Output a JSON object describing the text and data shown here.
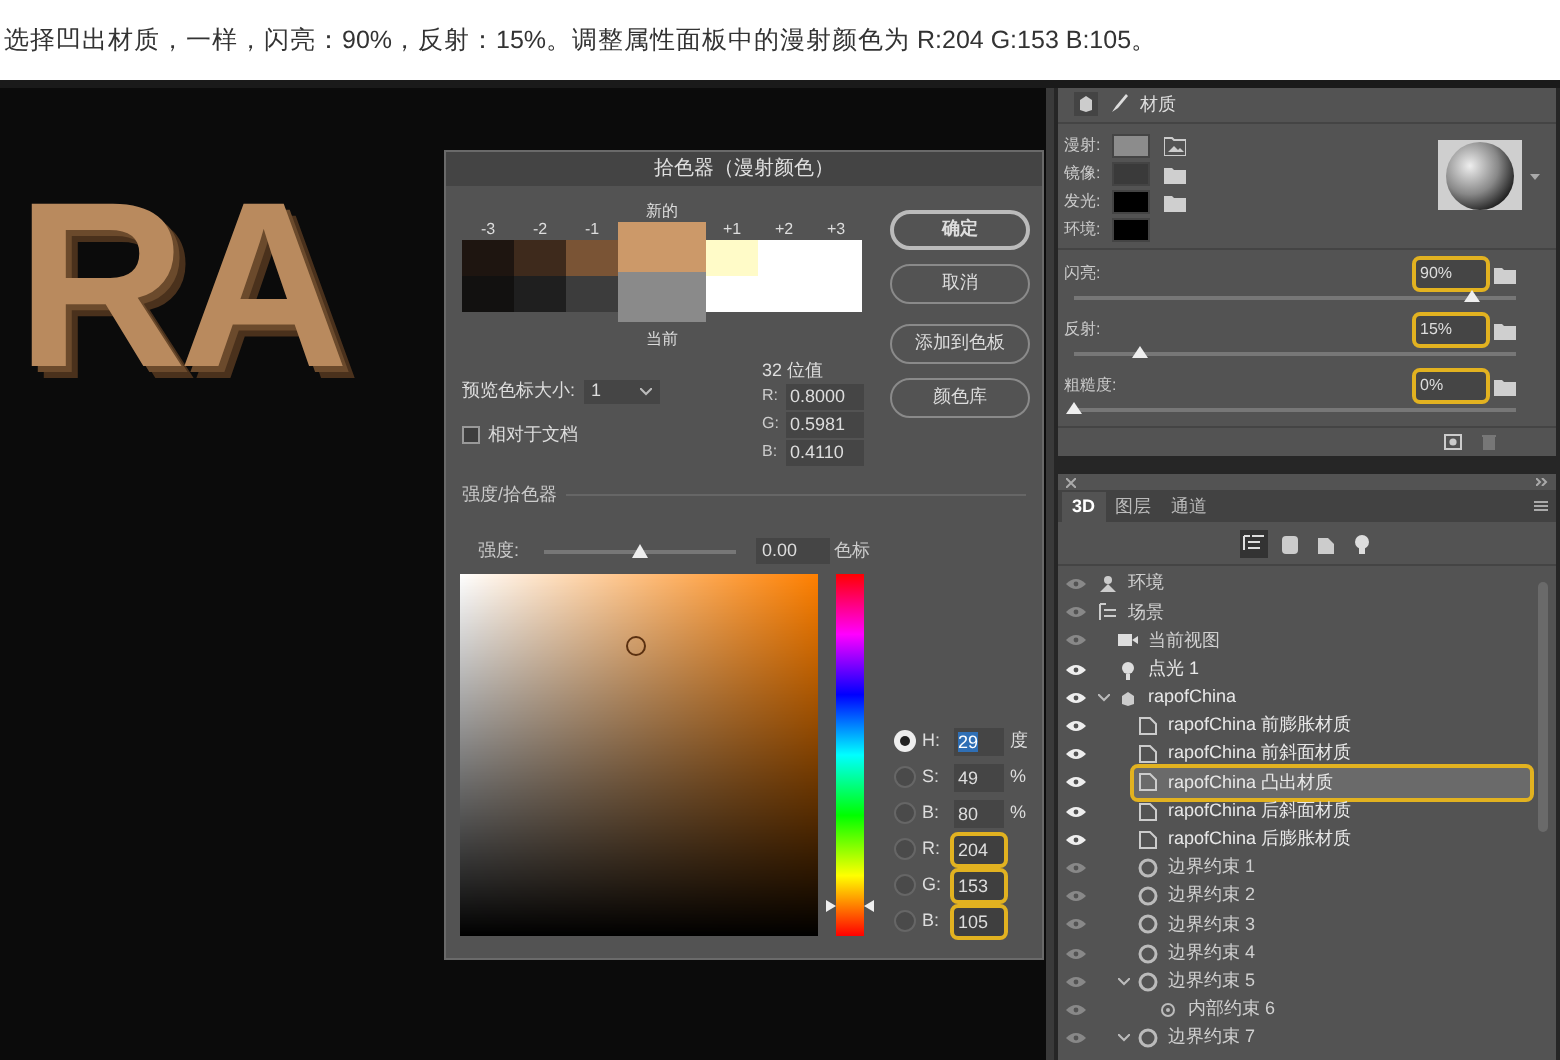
{
  "caption": "选择凹出材质，一样，闪亮：90%，反射：15%。调整属性面板中的漫射颜色为 R:204 G:153 B:105。",
  "canvas": {
    "text": "RA"
  },
  "color_picker": {
    "title": "拾色器（漫射颜色）",
    "preview": [
      {
        "label": "新的",
        "color": "#cc9969"
      },
      {
        "label": "当前",
        "color": "#8a8a8a"
      }
    ],
    "swatches": [
      {
        "label": "-3",
        "color": "#1e1510"
      },
      {
        "label": "-2",
        "color": "#3e2a1c"
      },
      {
        "label": "-1",
        "color": "#7a5435"
      },
      {
        "label": "+1",
        "color": "#fffbc8"
      },
      {
        "label": "+2",
        "color": "#ffffff"
      },
      {
        "label": "+3",
        "color": "#ffffff"
      }
    ],
    "swatches_lower": [
      {
        "color": "#121110"
      },
      {
        "color": "#1f1f1f"
      },
      {
        "color": "#3c3c3c"
      },
      {
        "color": "#ffffff"
      },
      {
        "color": "#ffffff"
      },
      {
        "color": "#ffffff"
      }
    ],
    "hue_slider": {
      "level": 0.08
    },
    "buttons": [
      {
        "label": "确定",
        "default": true
      },
      {
        "label": "取消",
        "default": false
      },
      {
        "label": "添加到色板",
        "default": false
      },
      {
        "label": "颜色库",
        "default": false
      }
    ],
    "preview_size": {
      "label": "预览色标大小:",
      "value": "1"
    },
    "relative_to_document": {
      "label": "相对于文档",
      "checked": false
    },
    "bit32": {
      "title": "32 位值",
      "fields": [
        {
          "label": "R:",
          "value": "0.8000"
        },
        {
          "label": "G:",
          "value": "0.5981"
        },
        {
          "label": "B:",
          "value": "0.4110"
        }
      ]
    },
    "section_title": "强度/拾色器",
    "intensity": {
      "label": "强度:",
      "level": 0.5,
      "value": "0.00",
      "unit": "色标"
    },
    "channels": [
      {
        "label": "H:",
        "value": "29",
        "unit": "度",
        "selected": true,
        "focused": true,
        "highlighted": false
      },
      {
        "label": "S:",
        "value": "49",
        "unit": "%",
        "selected": false,
        "focused": false,
        "highlighted": false
      },
      {
        "label": "B:",
        "value": "80",
        "unit": "%",
        "selected": false,
        "focused": false,
        "highlighted": false
      },
      {
        "label": "R:",
        "value": "204",
        "selected": false,
        "focused": false,
        "highlighted": true
      },
      {
        "label": "G:",
        "value": "153",
        "selected": false,
        "focused": false,
        "highlighted": true
      },
      {
        "label": "B:",
        "value": "105",
        "selected": false,
        "focused": false,
        "highlighted": true
      }
    ]
  },
  "properties": {
    "tab": "材质",
    "maps": [
      {
        "label": "漫射:",
        "color": "#8c8c8c",
        "kind": "texture"
      },
      {
        "label": "镜像:",
        "color": "#3a3a3a",
        "kind": "folder"
      },
      {
        "label": "发光:",
        "color": "#000000",
        "kind": "folder"
      },
      {
        "label": "环境:",
        "color": "#000000",
        "kind": "none"
      }
    ],
    "sliders": [
      {
        "label": "闪亮:",
        "value": "90%",
        "level": 0.9,
        "highlighted": true
      },
      {
        "label": "反射:",
        "value": "15%",
        "level": 0.15,
        "highlighted": true
      },
      {
        "label": "粗糙度:",
        "value": "0%",
        "level": 0,
        "highlighted": true
      }
    ]
  },
  "layers_panel": {
    "tabs": [
      {
        "label": "3D",
        "selected": true
      },
      {
        "label": "图层",
        "selected": false
      },
      {
        "label": "通道",
        "selected": false
      }
    ],
    "filters": [
      {
        "kind": "scene",
        "selected": true
      },
      {
        "kind": "mesh",
        "selected": false
      },
      {
        "kind": "material",
        "selected": false
      },
      {
        "kind": "light",
        "selected": false
      }
    ],
    "tree": [
      {
        "kind": "environment",
        "label": "环境",
        "visible": false,
        "expanded": false,
        "selected": false,
        "highlighted": false
      },
      {
        "kind": "scene",
        "label": "场景",
        "visible": false,
        "expanded": false,
        "selected": false,
        "highlighted": false,
        "children": [
          {
            "kind": "camera",
            "label": "当前视图",
            "visible": false,
            "expanded": false,
            "selected": false,
            "highlighted": false
          },
          {
            "kind": "light",
            "label": "点光 1",
            "visible": true,
            "expanded": false,
            "selected": false,
            "highlighted": false
          },
          {
            "kind": "mesh",
            "label": "rapofChina",
            "visible": true,
            "expanded": true,
            "selected": false,
            "highlighted": false,
            "children": [
              {
                "kind": "material",
                "label": "rapofChina 前膨胀材质",
                "visible": true,
                "expanded": false,
                "selected": false,
                "highlighted": false
              },
              {
                "kind": "material",
                "label": "rapofChina 前斜面材质",
                "visible": true,
                "expanded": false,
                "selected": false,
                "highlighted": false
              },
              {
                "kind": "material",
                "label": "rapofChina 凸出材质",
                "visible": true,
                "expanded": false,
                "selected": true,
                "highlighted": true
              },
              {
                "kind": "material",
                "label": "rapofChina 后斜面材质",
                "visible": true,
                "expanded": false,
                "selected": false,
                "highlighted": false
              },
              {
                "kind": "material",
                "label": "rapofChina 后膨胀材质",
                "visible": true,
                "expanded": false,
                "selected": false,
                "highlighted": false
              },
              {
                "kind": "constraint",
                "label": "边界约束 1",
                "visible": false,
                "expanded": false,
                "selected": false,
                "highlighted": false
              },
              {
                "kind": "constraint",
                "label": "边界约束 2",
                "visible": false,
                "expanded": false,
                "selected": false,
                "highlighted": false
              },
              {
                "kind": "constraint",
                "label": "边界约束 3",
                "visible": false,
                "expanded": false,
                "selected": false,
                "highlighted": false
              },
              {
                "kind": "constraint",
                "label": "边界约束 4",
                "visible": false,
                "expanded": false,
                "selected": false,
                "highlighted": false
              },
              {
                "kind": "constraint",
                "label": "边界约束 5",
                "visible": false,
                "expanded": true,
                "selected": false,
                "highlighted": false,
                "children": [
                  {
                    "kind": "inner",
                    "label": "内部约束 6",
                    "visible": false,
                    "expanded": false,
                    "selected": false,
                    "highlighted": false
                  }
                ]
              },
              {
                "kind": "constraint",
                "label": "边界约束 7",
                "visible": false,
                "expanded": true,
                "selected": false,
                "highlighted": false
              }
            ]
          }
        ]
      }
    ]
  }
}
